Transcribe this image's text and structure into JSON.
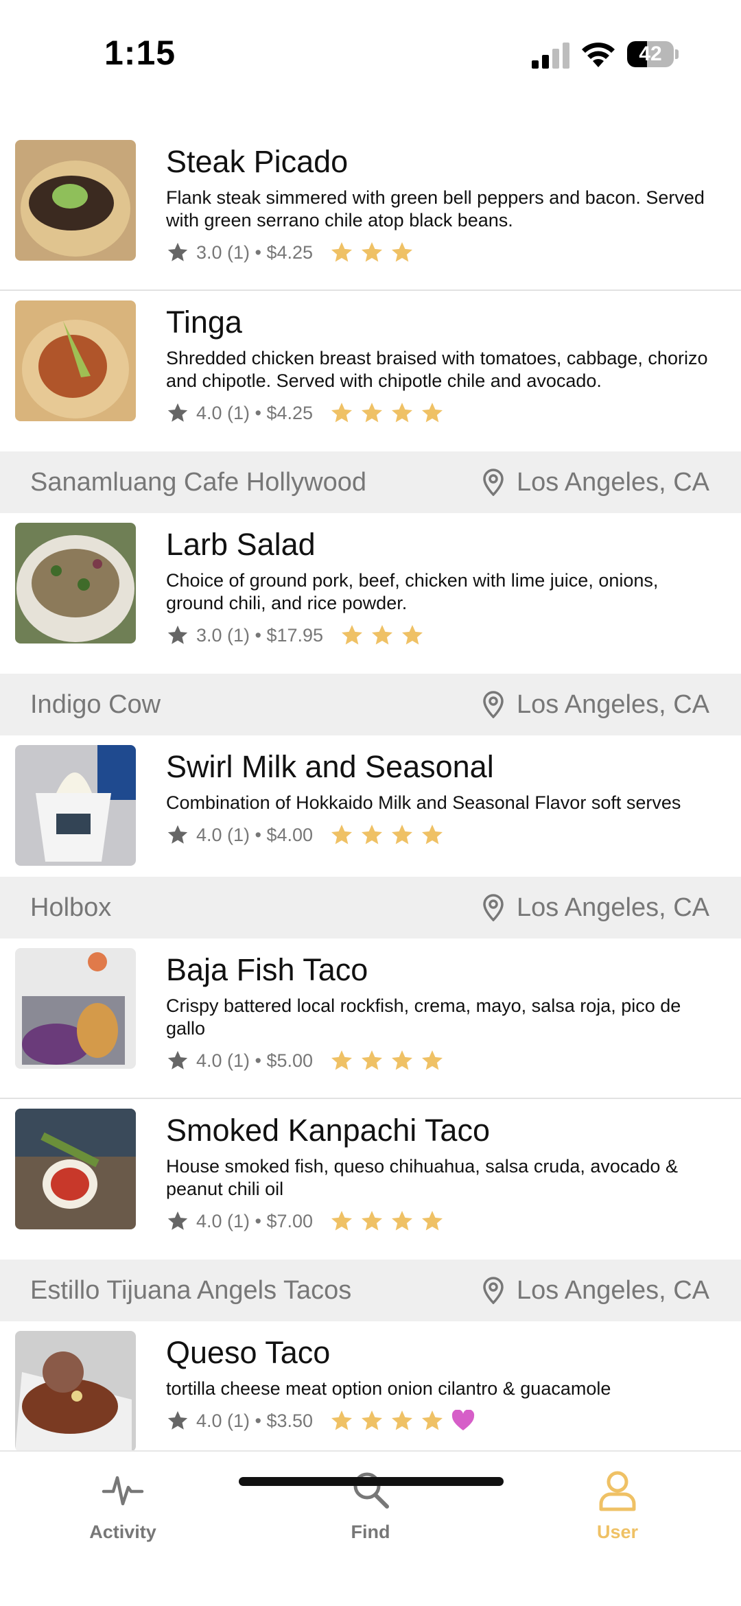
{
  "status_bar": {
    "time": "1:15",
    "battery": "42",
    "battery_level": 0.42
  },
  "feed": [
    {
      "kind": "dish",
      "title": "Steak Picado",
      "description": "Flank steak simmered with green bell peppers and bacon. Served with green serrano chile atop black beans.",
      "meta": "3.0 (1) • $4.25",
      "rating": 3,
      "favorite": false
    },
    {
      "kind": "dish",
      "title": "Tinga",
      "description": "Shredded chicken breast braised with tomatoes, cabbage, chorizo and chipotle.  Served with chipotle chile and avocado.",
      "meta": "4.0 (1) • $4.25",
      "rating": 4,
      "favorite": false
    },
    {
      "kind": "restaurant",
      "name": "Sanamluang Cafe Hollywood",
      "location": "Los Angeles, CA"
    },
    {
      "kind": "dish",
      "title": "Larb Salad",
      "description": "Choice of ground pork, beef, chicken with lime juice, onions, ground chili, and rice powder.",
      "meta": "3.0 (1) • $17.95",
      "rating": 3,
      "favorite": false
    },
    {
      "kind": "restaurant",
      "name": "Indigo Cow",
      "location": "Los Angeles, CA"
    },
    {
      "kind": "dish",
      "title": "Swirl Milk and Seasonal",
      "description": "Combination of Hokkaido Milk and Seasonal Flavor soft serves",
      "meta": "4.0 (1) • $4.00",
      "rating": 4,
      "favorite": false
    },
    {
      "kind": "restaurant",
      "name": "Holbox",
      "location": "Los Angeles, CA"
    },
    {
      "kind": "dish",
      "title": "Baja Fish Taco",
      "description": "Crispy battered local rockfish, crema, mayo, salsa roja, pico de gallo",
      "meta": "4.0 (1) • $5.00",
      "rating": 4,
      "favorite": false
    },
    {
      "kind": "dish",
      "title": "Smoked Kanpachi Taco",
      "description": "House smoked fish, queso chihuahua, salsa cruda, avocado & peanut chili oil",
      "meta": "4.0 (1) • $7.00",
      "rating": 4,
      "favorite": false
    },
    {
      "kind": "restaurant",
      "name": "Estillo Tijuana Angels Tacos",
      "location": "Los Angeles, CA"
    },
    {
      "kind": "dish",
      "title": "Queso Taco",
      "description": "tortilla cheese meat option onion cilantro & guacamole",
      "meta": "4.0 (1) • $3.50",
      "rating": 4,
      "favorite": true
    }
  ],
  "tabs": [
    {
      "label": "Activity",
      "icon": "activity-icon",
      "active": false
    },
    {
      "label": "Find",
      "icon": "search-icon",
      "active": false
    },
    {
      "label": "User",
      "icon": "user-icon",
      "active": true
    }
  ],
  "colors": {
    "accent": "#efc165",
    "star_gold": "#efc165",
    "meta_gray": "#777777",
    "heart": "#d65ec8",
    "header_bg": "#efefef"
  }
}
